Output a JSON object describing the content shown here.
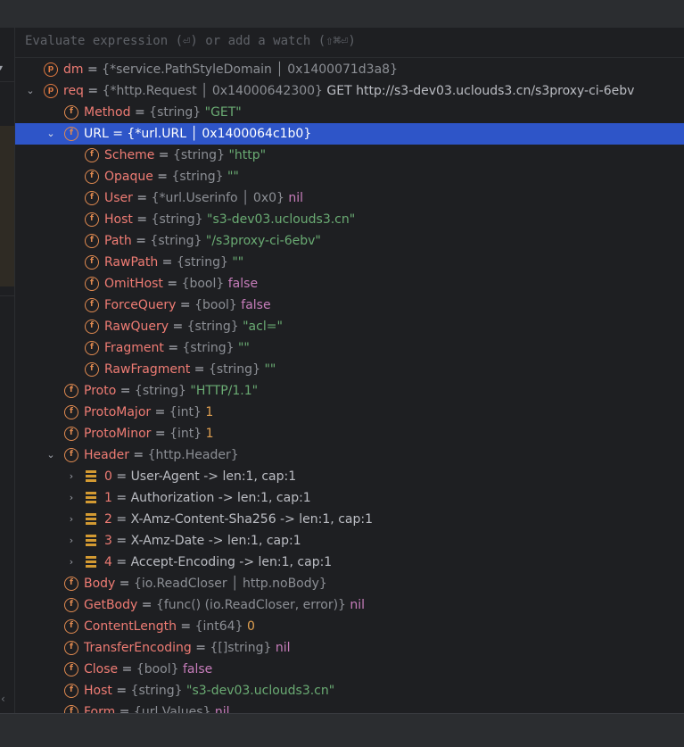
{
  "toolbar": {},
  "left_strip": {
    "top_chevron": "▾",
    "bottom_chevron": "‹"
  },
  "evaluate": {
    "placeholder": "Evaluate expression (⏎) or add a watch (⇧⌘⏎)"
  },
  "colors": {
    "background": "#1e1f22",
    "panel": "#2b2d30",
    "selection": "#2e55c8",
    "name": "#ef7c74",
    "string": "#6aab73",
    "keyword": "#c77dbb",
    "number": "#e0a050",
    "type": "#8c8f95",
    "icon": "#e08a50"
  },
  "tree": [
    {
      "icon": "p",
      "toggle": "",
      "name": "dm",
      "type": "{*service.PathStyleDomain │ 0x1400071d3a8}"
    },
    {
      "icon": "p",
      "toggle": "⌄",
      "name": "req",
      "type": "{*http.Request │ 0x14000642300}",
      "value": "GET http://s3-dev03.uclouds3.cn/s3proxy-ci-6ebv",
      "vk": "v"
    },
    {
      "icon": "f",
      "toggle": "",
      "name": "Method",
      "type": "{string}",
      "value": "\"GET\"",
      "vk": "s"
    },
    {
      "icon": "f",
      "toggle": "⌄",
      "name": "URL",
      "type": "{*url.URL │ 0x1400064c1b0}",
      "selected": true
    },
    {
      "icon": "f",
      "toggle": "",
      "name": "Scheme",
      "type": "{string}",
      "value": "\"http\"",
      "vk": "s"
    },
    {
      "icon": "f",
      "toggle": "",
      "name": "Opaque",
      "type": "{string}",
      "value": "\"\"",
      "vk": "s"
    },
    {
      "icon": "f",
      "toggle": "",
      "name": "User",
      "type": "{*url.Userinfo │ 0x0}",
      "value": "nil",
      "vk": "k"
    },
    {
      "icon": "f",
      "toggle": "",
      "name": "Host",
      "type": "{string}",
      "value": "\"s3-dev03.uclouds3.cn\"",
      "vk": "s"
    },
    {
      "icon": "f",
      "toggle": "",
      "name": "Path",
      "type": "{string}",
      "value": "\"/s3proxy-ci-6ebv\"",
      "vk": "s"
    },
    {
      "icon": "f",
      "toggle": "",
      "name": "RawPath",
      "type": "{string}",
      "value": "\"\"",
      "vk": "s"
    },
    {
      "icon": "f",
      "toggle": "",
      "name": "OmitHost",
      "type": "{bool}",
      "value": "false",
      "vk": "k"
    },
    {
      "icon": "f",
      "toggle": "",
      "name": "ForceQuery",
      "type": "{bool}",
      "value": "false",
      "vk": "k"
    },
    {
      "icon": "f",
      "toggle": "",
      "name": "RawQuery",
      "type": "{string}",
      "value": "\"acl=\"",
      "vk": "s"
    },
    {
      "icon": "f",
      "toggle": "",
      "name": "Fragment",
      "type": "{string}",
      "value": "\"\"",
      "vk": "s"
    },
    {
      "icon": "f",
      "toggle": "",
      "name": "RawFragment",
      "type": "{string}",
      "value": "\"\"",
      "vk": "s"
    },
    {
      "icon": "f",
      "toggle": "",
      "name": "Proto",
      "type": "{string}",
      "value": "\"HTTP/1.1\"",
      "vk": "s"
    },
    {
      "icon": "f",
      "toggle": "",
      "name": "ProtoMajor",
      "type": "{int}",
      "value": "1",
      "vk": "num"
    },
    {
      "icon": "f",
      "toggle": "",
      "name": "ProtoMinor",
      "type": "{int}",
      "value": "1",
      "vk": "num"
    },
    {
      "icon": "f",
      "toggle": "⌄",
      "name": "Header",
      "type": "{http.Header}"
    },
    {
      "icon": "list",
      "toggle": "›",
      "name": "0",
      "value": "User-Agent -> len:1, cap:1",
      "vk": "v",
      "plain": true
    },
    {
      "icon": "list",
      "toggle": "›",
      "name": "1",
      "value": "Authorization -> len:1, cap:1",
      "vk": "v",
      "plain": true
    },
    {
      "icon": "list",
      "toggle": "›",
      "name": "2",
      "value": "X-Amz-Content-Sha256 -> len:1, cap:1",
      "vk": "v",
      "plain": true
    },
    {
      "icon": "list",
      "toggle": "›",
      "name": "3",
      "value": "X-Amz-Date -> len:1, cap:1",
      "vk": "v",
      "plain": true
    },
    {
      "icon": "list",
      "toggle": "›",
      "name": "4",
      "value": "Accept-Encoding -> len:1, cap:1",
      "vk": "v",
      "plain": true
    },
    {
      "icon": "f",
      "toggle": "",
      "name": "Body",
      "type": "{io.ReadCloser │ http.noBody}"
    },
    {
      "icon": "f",
      "toggle": "",
      "name": "GetBody",
      "type": "{func() (io.ReadCloser, error)}",
      "value": "nil",
      "vk": "k"
    },
    {
      "icon": "f",
      "toggle": "",
      "name": "ContentLength",
      "type": "{int64}",
      "value": "0",
      "vk": "num"
    },
    {
      "icon": "f",
      "toggle": "",
      "name": "TransferEncoding",
      "type": "{[]string}",
      "value": "nil",
      "vk": "k"
    },
    {
      "icon": "f",
      "toggle": "",
      "name": "Close",
      "type": "{bool}",
      "value": "false",
      "vk": "k"
    },
    {
      "icon": "f",
      "toggle": "",
      "name": "Host",
      "type": "{string}",
      "value": "\"s3-dev03.uclouds3.cn\"",
      "vk": "s"
    },
    {
      "icon": "f",
      "toggle": "",
      "name": "Form",
      "type": "{url.Values}",
      "value": "nil",
      "vk": "k"
    }
  ]
}
